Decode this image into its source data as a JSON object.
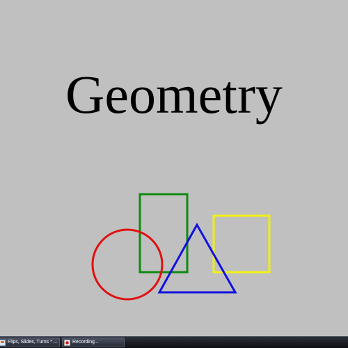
{
  "slide": {
    "title": "Geometry",
    "shapes": {
      "circle_color": "#e01010",
      "rectangle_color": "#108a10",
      "triangle_color": "#1010e0",
      "square_color": "#f0f010"
    }
  },
  "taskbar": {
    "items": [
      {
        "label": "Flips, Slides, Turns * ...",
        "icon": "presentation-icon"
      },
      {
        "label": "Recording...",
        "icon": "recorder-icon"
      }
    ]
  }
}
